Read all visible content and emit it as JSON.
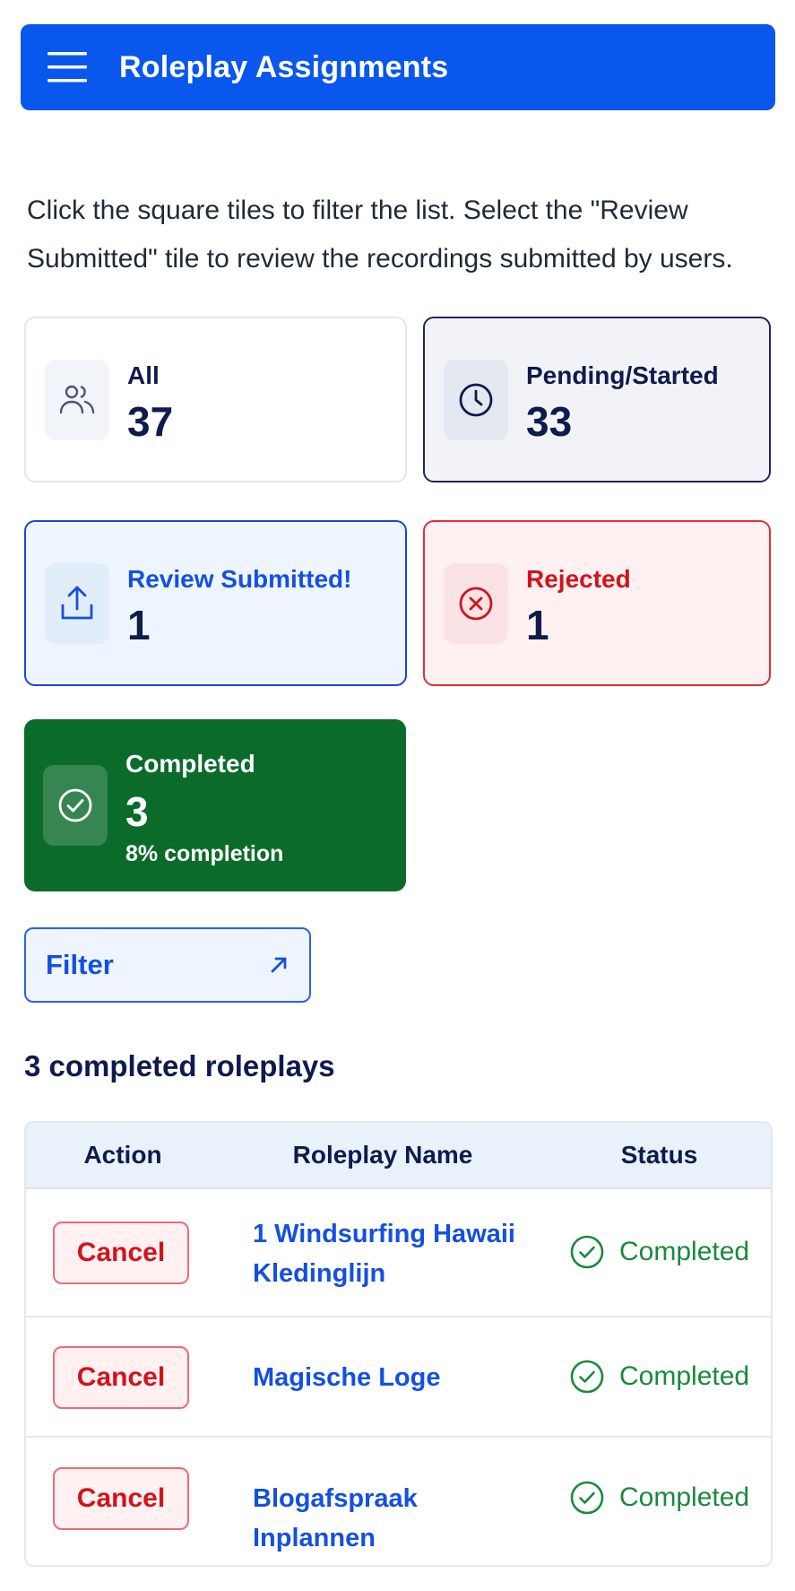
{
  "header": {
    "title": "Roleplay Assignments",
    "menu_icon": "hamburger-menu-icon",
    "background_color": "#0a57ee"
  },
  "instructions": "Click the square tiles to filter the list. Select the \"Review Submitted\" tile to review the recordings submitted by users.",
  "tiles": {
    "all": {
      "label": "All",
      "count": "37",
      "icon": "users-icon"
    },
    "pending": {
      "label": "Pending/Started",
      "count": "33",
      "icon": "clock-icon"
    },
    "review": {
      "label": "Review Submitted!",
      "count": "1",
      "icon": "upload-icon",
      "accent": "#1450e0"
    },
    "rejected": {
      "label": "Rejected",
      "count": "1",
      "icon": "x-circle-icon",
      "accent": "#d3131b"
    },
    "completed": {
      "label": "Completed",
      "count": "3",
      "subtitle": "8% completion",
      "icon": "check-circle-icon",
      "background": "#0b6b2b"
    }
  },
  "filter": {
    "label": "Filter",
    "icon": "arrow-up-right-icon"
  },
  "list": {
    "title": "3 completed roleplays",
    "columns": [
      "Action",
      "Roleplay Name",
      "Status"
    ],
    "rows": [
      {
        "action": "Cancel",
        "name": "1 Windsurfing Hawaii Kledinglijn",
        "status": "Completed"
      },
      {
        "action": "Cancel",
        "name": "Magische Loge",
        "status": "Completed"
      },
      {
        "action": "Cancel",
        "name": "Blogafspraak Inplannen",
        "status": "Completed"
      }
    ],
    "status_color": "#1a8a3a"
  }
}
